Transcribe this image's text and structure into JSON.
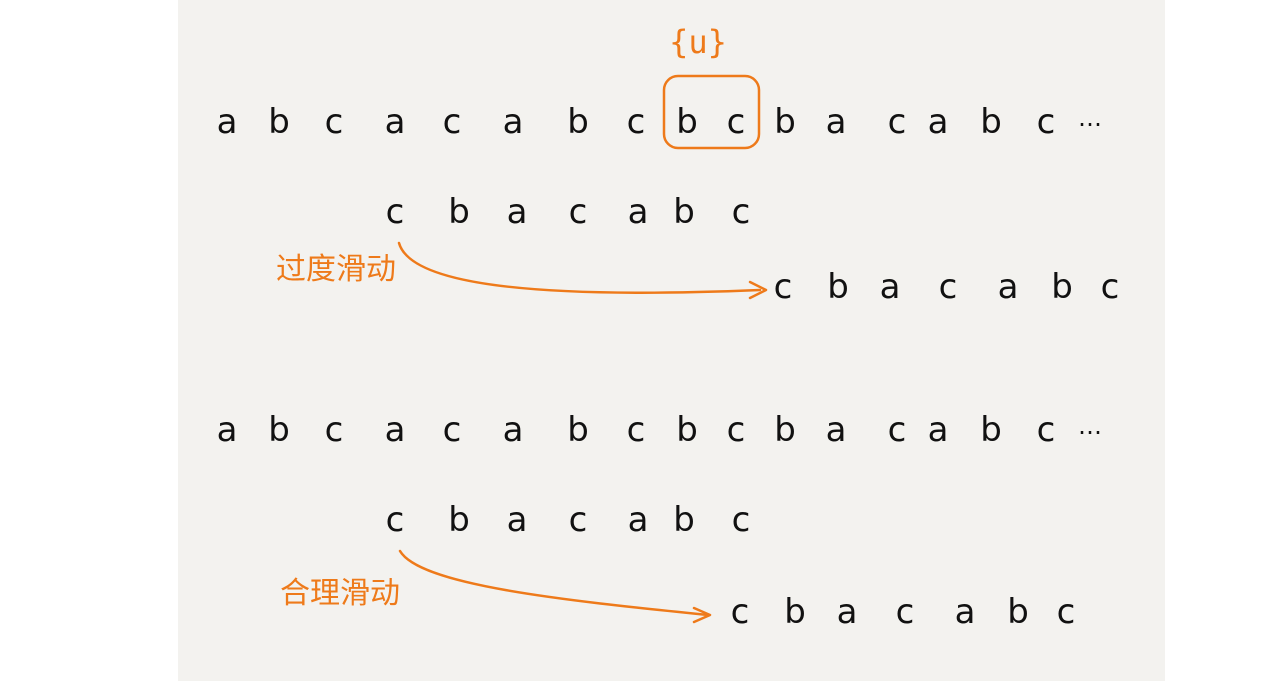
{
  "colors": {
    "accent": "#ee7a1a",
    "ink": "#111111",
    "paper": "#f3f2ef"
  },
  "top_panel": {
    "main_row": [
      "a",
      "b",
      "c",
      "a",
      "c",
      "a",
      "b",
      "c",
      "b",
      "c",
      "b",
      "a",
      "c",
      "a",
      "b",
      "c"
    ],
    "main_row_ellipsis": "…",
    "bad_char_label": "{u}",
    "pattern_before": [
      "c",
      "b",
      "a",
      "c",
      "a",
      "b",
      "c"
    ],
    "pattern_after": [
      "c",
      "b",
      "a",
      "c",
      "a",
      "b",
      "c"
    ],
    "slide_label": "过度滑动"
  },
  "bottom_panel": {
    "main_row": [
      "a",
      "b",
      "c",
      "a",
      "c",
      "a",
      "b",
      "c",
      "b",
      "c",
      "b",
      "a",
      "c",
      "a",
      "b",
      "c"
    ],
    "main_row_ellipsis": "…",
    "pattern_before": [
      "c",
      "b",
      "a",
      "c",
      "a",
      "b",
      "c"
    ],
    "pattern_after": [
      "c",
      "b",
      "a",
      "c",
      "a",
      "b",
      "c"
    ],
    "slide_label": "合理滑动"
  }
}
